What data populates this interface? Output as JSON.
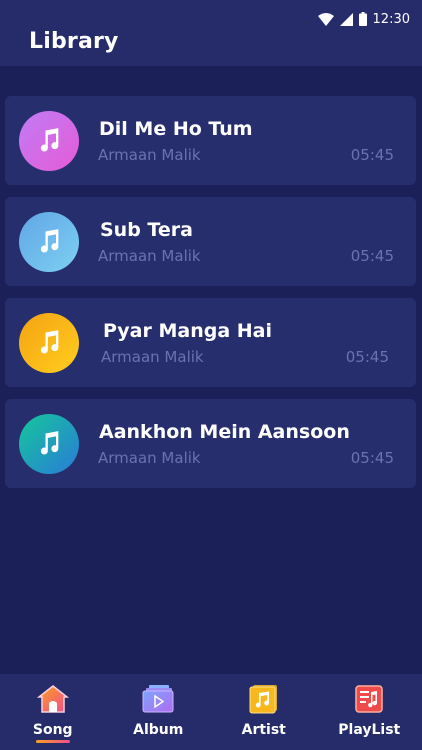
{
  "status_bar": {
    "time": "12:30"
  },
  "header": {
    "title": "Library"
  },
  "songs": [
    {
      "title": "Dil Me Ho Tum",
      "artist": "Armaan Malik",
      "duration": "05:45"
    },
    {
      "title": "Sub Tera",
      "artist": "Armaan Malik",
      "duration": "05:45"
    },
    {
      "title": "Pyar Manga Hai",
      "artist": "Armaan Malik",
      "duration": "05:45"
    },
    {
      "title": "Aankhon Mein Aansoon",
      "artist": "Armaan Malik",
      "duration": "05:45"
    }
  ],
  "nav": [
    {
      "label": "Song",
      "icon": "home-icon",
      "active": true
    },
    {
      "label": "Album",
      "icon": "album-icon",
      "active": false
    },
    {
      "label": "Artist",
      "icon": "artist-note-icon",
      "active": false
    },
    {
      "label": "PlayList",
      "icon": "playlist-icon",
      "active": false
    }
  ],
  "colors": {
    "art_gradients": [
      [
        "#c07cf6",
        "#e65bd6"
      ],
      [
        "#61a6e6",
        "#7dd0f2"
      ],
      [
        "#f5a312",
        "#ffcd1f"
      ],
      [
        "#15c79b",
        "#2a7ad8"
      ]
    ]
  }
}
